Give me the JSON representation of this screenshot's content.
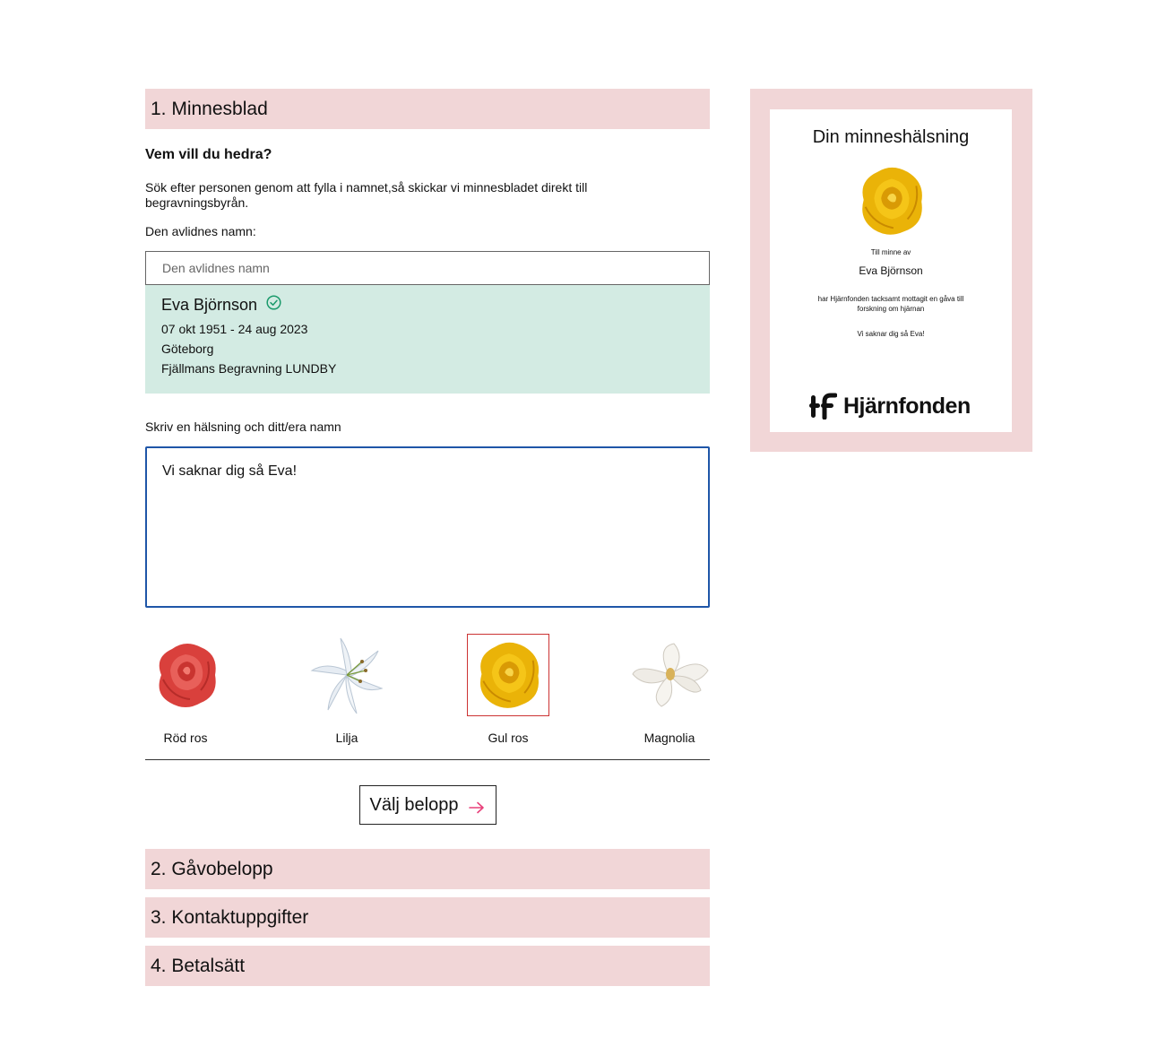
{
  "steps": {
    "step1": "1. Minnesblad",
    "step2": "2. Gåvobelopp",
    "step3": "3. Kontaktuppgifter",
    "step4": "4. Betalsätt"
  },
  "memorial": {
    "question": "Vem vill du hedra?",
    "description": "Sök efter personen genom att fylla i namnet,så skickar vi minnesbladet direkt till begravningsbyrån.",
    "name_label": "Den avlidnes namn:",
    "name_placeholder": "Den avlidnes namn",
    "name_value": "",
    "result": {
      "name": "Eva Björnson",
      "dates": "07 okt 1951 - 24 aug 2023",
      "city": "Göteborg",
      "funeral_home": "Fjällmans Begravning LUNDBY"
    },
    "greeting_label": "Skriv en hälsning och ditt/era namn",
    "greeting_value": "Vi saknar dig så Eva!",
    "flowers": [
      {
        "name": "Röd ros",
        "icon": "red-rose-icon",
        "selected": false
      },
      {
        "name": "Lilja",
        "icon": "lily-icon",
        "selected": false
      },
      {
        "name": "Gul ros",
        "icon": "yellow-rose-icon",
        "selected": true
      },
      {
        "name": "Magnolia",
        "icon": "magnolia-icon",
        "selected": false
      }
    ],
    "cta_label": "Välj belopp",
    "cta_icon": "arrow-right-icon"
  },
  "preview": {
    "title": "Din minneshälsning",
    "in_memory": "Till minne av",
    "name": "Eva Björnson",
    "message": "har Hjärnfonden tacksamt mottagit en gåva till forskning om hjärnan",
    "greeting": "Vi saknar dig så Eva!",
    "logo_text": "Hjärnfonden"
  },
  "colors": {
    "section_bg": "#f1d6d7",
    "result_bg": "#d3ebe3",
    "focus_border": "#1f56a8",
    "check_green": "#1a9a6b",
    "arrow_pink": "#e8407a",
    "selected_outline": "#cc3333"
  }
}
